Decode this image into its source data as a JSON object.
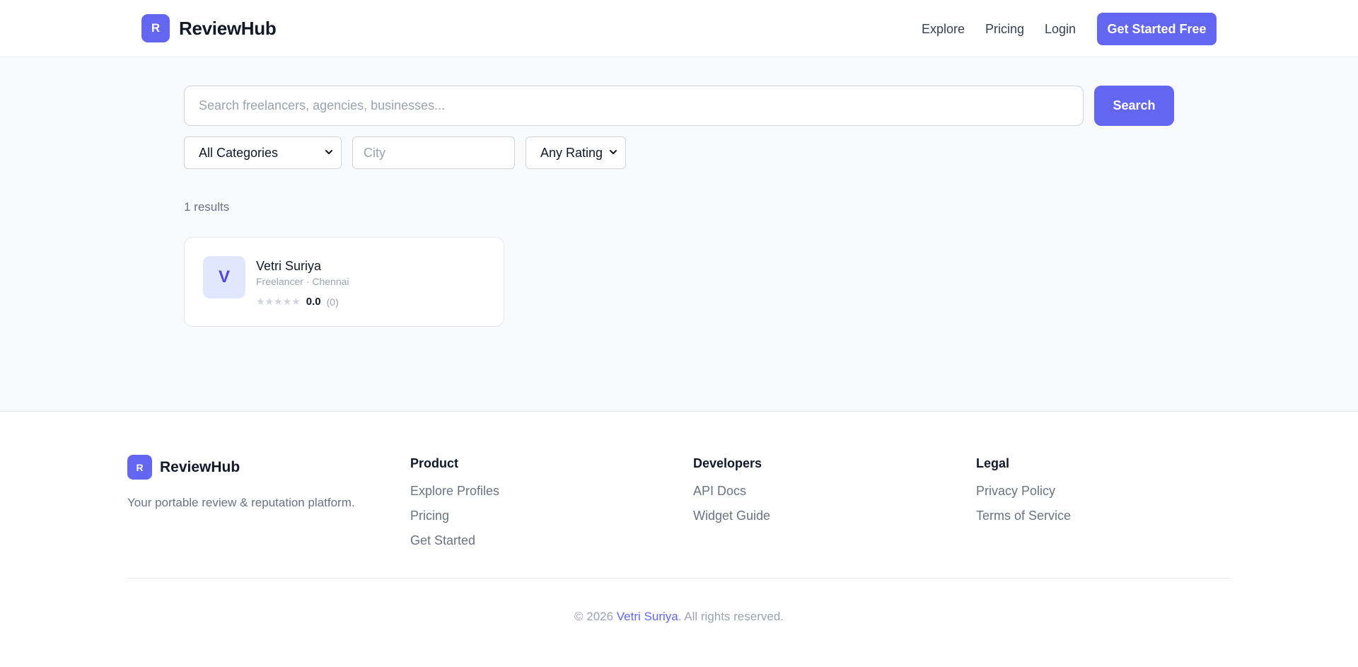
{
  "header": {
    "logo_letter": "R",
    "brand": "ReviewHub",
    "nav": {
      "explore": "Explore",
      "pricing": "Pricing",
      "login": "Login"
    },
    "cta": "Get Started Free"
  },
  "search": {
    "placeholder": "Search freelancers, agencies, businesses...",
    "button": "Search",
    "category_selected": "All Categories",
    "city_placeholder": "City",
    "rating_selected": "Any Rating"
  },
  "results": {
    "count_label": "1 results",
    "items": [
      {
        "initial": "V",
        "name": "Vetri Suriya",
        "meta": "Freelancer · Chennai",
        "stars": "★★★★★",
        "score": "0.0",
        "reviews": "(0)"
      }
    ]
  },
  "footer": {
    "logo_letter": "R",
    "brand": "ReviewHub",
    "tagline": "Your portable review & reputation platform.",
    "columns": [
      {
        "title": "Product",
        "links": [
          "Explore Profiles",
          "Pricing",
          "Get Started"
        ]
      },
      {
        "title": "Developers",
        "links": [
          "API Docs",
          "Widget Guide"
        ]
      },
      {
        "title": "Legal",
        "links": [
          "Privacy Policy",
          "Terms of Service"
        ]
      }
    ],
    "copyright_prefix": "© 2026 ",
    "copyright_owner": "Vetri Suriya",
    "copyright_suffix": ". All rights reserved."
  },
  "colors": {
    "accent": "#6366f1",
    "avatar_bg": "#e0e7ff",
    "page_bg": "#f9fafb"
  }
}
